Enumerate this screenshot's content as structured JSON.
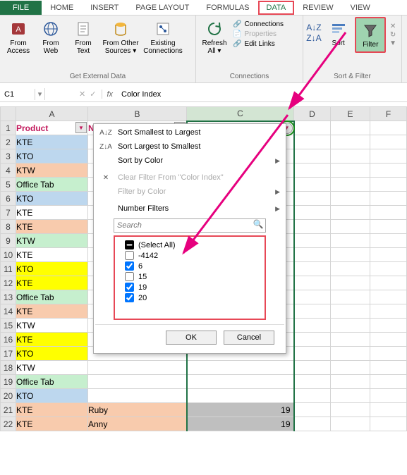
{
  "tabs": {
    "file": "FILE",
    "home": "HOME",
    "insert": "INSERT",
    "pagelayout": "PAGE LAYOUT",
    "formulas": "FORMULAS",
    "data": "DATA",
    "review": "REVIEW",
    "view": "VIEW"
  },
  "ribbon": {
    "ext": {
      "access": "From Access",
      "web": "From Web",
      "text": "From Text",
      "other": "From Other Sources ▾",
      "existing": "Existing Connections",
      "label": "Get External Data"
    },
    "conn": {
      "refresh": "Refresh All ▾",
      "connections": "Connections",
      "properties": "Properties",
      "editlinks": "Edit Links",
      "label": "Connections"
    },
    "sortfilter": {
      "sort": "Sort",
      "filter": "Filter",
      "label": "Sort & Filter"
    }
  },
  "formula_bar": {
    "name": "C1",
    "fx": "fx",
    "value": "Color Index"
  },
  "columns": [
    "",
    "A",
    "B",
    "C",
    "D",
    "E",
    "F"
  ],
  "headers": {
    "a": "Product",
    "b": "Name",
    "c": "Color Index"
  },
  "rows": [
    {
      "n": 1,
      "a": "Product",
      "b": "Name",
      "c": "Color Index",
      "hdr": true
    },
    {
      "n": 2,
      "a": "KTE",
      "b": "",
      "c": "",
      "cls": "bg-blue"
    },
    {
      "n": 3,
      "a": "KTO",
      "b": "",
      "c": "",
      "cls": "bg-blue"
    },
    {
      "n": 4,
      "a": "KTW",
      "b": "",
      "c": "",
      "cls": "bg-pink"
    },
    {
      "n": 5,
      "a": "Office Tab",
      "b": "",
      "c": "",
      "cls": "bg-green"
    },
    {
      "n": 6,
      "a": "KTO",
      "b": "",
      "c": "",
      "cls": "bg-blue"
    },
    {
      "n": 7,
      "a": "KTE",
      "b": "",
      "c": "",
      "cls": "bg-white"
    },
    {
      "n": 8,
      "a": "KTE",
      "b": "",
      "c": "",
      "cls": "bg-pink"
    },
    {
      "n": 9,
      "a": "KTW",
      "b": "",
      "c": "",
      "cls": "bg-green"
    },
    {
      "n": 10,
      "a": "KTE",
      "b": "",
      "c": "",
      "cls": "bg-white"
    },
    {
      "n": 11,
      "a": "KTO",
      "b": "",
      "c": "",
      "cls": "bg-yellow"
    },
    {
      "n": 12,
      "a": "KTE",
      "b": "",
      "c": "",
      "cls": "bg-yellow"
    },
    {
      "n": 13,
      "a": "Office Tab",
      "b": "",
      "c": "",
      "cls": "bg-green"
    },
    {
      "n": 14,
      "a": "KTE",
      "b": "",
      "c": "",
      "cls": "bg-pink"
    },
    {
      "n": 15,
      "a": "KTW",
      "b": "",
      "c": "",
      "cls": "bg-white"
    },
    {
      "n": 16,
      "a": "KTE",
      "b": "",
      "c": "",
      "cls": "bg-yellow"
    },
    {
      "n": 17,
      "a": "KTO",
      "b": "",
      "c": "",
      "cls": "bg-yellow"
    },
    {
      "n": 18,
      "a": "KTW",
      "b": "",
      "c": "",
      "cls": "bg-white"
    },
    {
      "n": 19,
      "a": "Office Tab",
      "b": "",
      "c": "",
      "cls": "bg-green"
    },
    {
      "n": 20,
      "a": "KTO",
      "b": "",
      "c": "",
      "cls": "bg-blue"
    },
    {
      "n": 21,
      "a": "KTE",
      "b": "Ruby",
      "c": "19",
      "cls": "bg-pink",
      "vis": true
    },
    {
      "n": 22,
      "a": "KTE",
      "b": "Anny",
      "c": "19",
      "cls": "bg-pink",
      "vis": true
    }
  ],
  "popup": {
    "sort_asc": "Sort Smallest to Largest",
    "sort_desc": "Sort Largest to Smallest",
    "sort_color": "Sort by Color",
    "clear": "Clear Filter From \"Color Index\"",
    "filter_color": "Filter by Color",
    "number_filters": "Number Filters",
    "search_placeholder": "Search",
    "select_all": "(Select All)",
    "items": [
      {
        "label": "-4142",
        "checked": false
      },
      {
        "label": "6",
        "checked": true
      },
      {
        "label": "15",
        "checked": false
      },
      {
        "label": "19",
        "checked": true
      },
      {
        "label": "20",
        "checked": true
      }
    ],
    "ok": "OK",
    "cancel": "Cancel"
  }
}
